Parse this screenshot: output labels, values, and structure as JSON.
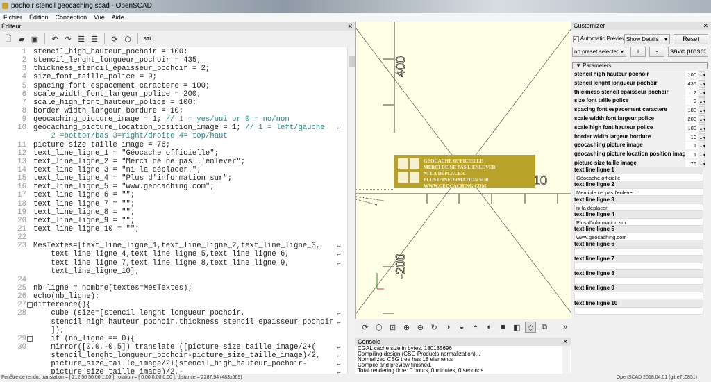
{
  "window": {
    "title": "pochoir stencil geocaching.scad - OpenSCAD"
  },
  "menu": [
    "Fichier",
    "Édition",
    "Conception",
    "Vue",
    "Aide"
  ],
  "editor": {
    "title": "Éditeur",
    "toolbar_icons": [
      "new-file-icon",
      "open-file-icon",
      "save-icon",
      "undo-icon",
      "redo-icon",
      "unindent-icon",
      "indent-icon",
      "preview-icon",
      "render-icon",
      "export-stl-icon"
    ],
    "stl_label": "STL",
    "lines": [
      {
        "n": "1",
        "t": "stencil_high_hauteur_pochoir = 100;"
      },
      {
        "n": "2",
        "t": "stencil_lenght_longueur_pochoir = 435;"
      },
      {
        "n": "3",
        "t": "thickness_stencil_epaisseur_pochoir = 2;"
      },
      {
        "n": "4",
        "t": "size_font_taille_police = 9;"
      },
      {
        "n": "5",
        "t": "spacing_font_espacement_caractere = 100;"
      },
      {
        "n": "6",
        "t": "scale_width_font_largeur_police = 200;"
      },
      {
        "n": "7",
        "t": "scale_high_font_hauteur_police = 100;"
      },
      {
        "n": "8",
        "t": "border_width_largeur_bordure = 10;"
      },
      {
        "n": "9",
        "t": "geocaching_picture_image = 1; ",
        "c": "// 1 = yes/oui or 0 = no/non"
      },
      {
        "n": "10",
        "t": "geocaching_picture_location_position_image = 1; ",
        "c": "// 1 = left/gauche",
        "w": true
      },
      {
        "n": "",
        "t": "    ",
        "c": "2 =bottom/bas 3=right/droite 4= top/haut"
      },
      {
        "n": "11",
        "t": "picture_size_taille_image = 76;"
      },
      {
        "n": "12",
        "t": "text_line_ligne_1 = \"Géocache officielle\";"
      },
      {
        "n": "13",
        "t": "text_line_ligne_2 = \"Merci de ne pas l'enlever\";"
      },
      {
        "n": "14",
        "t": "text_line_ligne_3 = \"ni la déplacer.\";"
      },
      {
        "n": "15",
        "t": "text_line_ligne_4 = \"Plus d'information sur\";"
      },
      {
        "n": "16",
        "t": "text_line_ligne_5 = \"www.geocaching.com\";"
      },
      {
        "n": "17",
        "t": "text_line_ligne_6 = \"\";"
      },
      {
        "n": "18",
        "t": "text_line_ligne_7 = \"\";"
      },
      {
        "n": "19",
        "t": "text_line_ligne_8 = \"\";"
      },
      {
        "n": "20",
        "t": "text_line_ligne_9 = \"\";"
      },
      {
        "n": "21",
        "t": "text_line_ligne_10 = \"\";"
      },
      {
        "n": "22",
        "t": ""
      },
      {
        "n": "23",
        "t": "MesTextes=[text_line_ligne_1,text_line_ligne_2,text_line_ligne_3,",
        "w": true
      },
      {
        "n": "",
        "t": "    text_line_ligne_4,text_line_ligne_5,text_line_ligne_6,",
        "w": true
      },
      {
        "n": "",
        "t": "    text_line_ligne_7,text_line_ligne_8,text_line_ligne_9,",
        "w": true
      },
      {
        "n": "",
        "t": "    text_line_ligne_10];"
      },
      {
        "n": "24",
        "t": ""
      },
      {
        "n": "25",
        "t": "nb_ligne = nombre(textes=MesTextes);"
      },
      {
        "n": "26",
        "t": "echo(nb_ligne);"
      },
      {
        "n": "27",
        "t": "difference(){",
        "f": true
      },
      {
        "n": "28",
        "t": "    cube (size=[stencil_lenght_longueur_pochoir,",
        "w": true
      },
      {
        "n": "",
        "t": "    stencil_high_hauteur_pochoir,thickness_stencil_epaisseur_pochoir",
        "w": true
      },
      {
        "n": "",
        "t": "    ]);"
      },
      {
        "n": "29",
        "t": "    if (nb_ligne == 0){",
        "f": true
      },
      {
        "n": "30",
        "t": "    mirror([0,0,-0.5]) translate ([picture_size_taille_image/2+(",
        "w": true
      },
      {
        "n": "",
        "t": "    stencil_lenght_longueur_pochoir-picture_size_taille_image)/2,",
        "w": true
      },
      {
        "n": "",
        "t": "    picture_size_taille_image/2+(stencil_high_hauteur_pochoir-",
        "w": true
      },
      {
        "n": "",
        "t": "    picture_size_taille_image)/2,-",
        "w": true
      }
    ]
  },
  "viewport": {
    "background": "#ffffe5",
    "stencil_color": "#b8a22a",
    "axis_labels": [
      "400",
      "200",
      "-200",
      "10"
    ],
    "stencil_text": [
      "GÉOCACHE OFFICIELLE",
      "MERCI DE NE PAS L'ENLEVER",
      "NI LA DÉPLACER.",
      "PLUS D'INFORMATION SUR",
      "WWW.GEOCACHING.COM"
    ],
    "toolbar_icons": [
      "preview-icon",
      "render-icon",
      "zoom-all-icon",
      "zoom-in-icon",
      "zoom-out-icon",
      "reset-view-icon",
      "view-right-icon",
      "view-top-icon",
      "view-bottom-icon",
      "view-left-icon",
      "view-front-icon",
      "view-back-icon",
      "perspective-icon",
      "orthogonal-icon"
    ],
    "more": "»"
  },
  "console": {
    "title": "Console",
    "lines": [
      "CGAL cache size in bytes: 180185696",
      "Compiling design (CSG Products normalization)...",
      "Normalized CSG tree has 18 elements",
      "Compile and preview finished.",
      "Total rendering time: 0 hours, 0 minutes, 0 seconds"
    ]
  },
  "customizer": {
    "title": "Customizer",
    "auto_preview_label": "Automatic Preview",
    "auto_preview_checked": true,
    "details_select": "Show Details",
    "reset": "Reset",
    "preset_select": "no preset selected",
    "plus": "+",
    "minus": "-",
    "save_preset": "save preset",
    "section": "Parameters",
    "params": [
      {
        "label": "stencil high hauteur pochoir",
        "value": "100"
      },
      {
        "label": "stencil lenght longueur pochoir",
        "value": "435"
      },
      {
        "label": "thickness stencil epaisseur pochoir",
        "value": "2"
      },
      {
        "label": "size font taille police",
        "value": "9"
      },
      {
        "label": "spacing font espacement caractere",
        "value": "100"
      },
      {
        "label": "scale width font largeur police",
        "value": "200"
      },
      {
        "label": "scale high font hauteur police",
        "value": "100"
      },
      {
        "label": "border width largeur bordure",
        "value": "10"
      },
      {
        "label": "geocaching picture image",
        "value": "1"
      },
      {
        "label": "geocaching picture location position image",
        "value": "1"
      },
      {
        "label": "picture size taille image",
        "value": "76"
      }
    ],
    "text_lines": [
      {
        "label": "text line ligne 1",
        "value": "Géocache officielle"
      },
      {
        "label": "text line ligne 2",
        "value": "Merci de ne pas l'enlever"
      },
      {
        "label": "text line ligne 3",
        "value": "ni la déplacer."
      },
      {
        "label": "text line ligne 4",
        "value": "Plus d'information sur"
      },
      {
        "label": "text line ligne 5",
        "value": "www.geocaching.com"
      },
      {
        "label": "text line ligne 6",
        "value": ""
      },
      {
        "label": "text line ligne 7",
        "value": ""
      },
      {
        "label": "text line ligne 8",
        "value": ""
      },
      {
        "label": "text line ligne 9",
        "value": ""
      },
      {
        "label": "text line ligne 10",
        "value": ""
      }
    ]
  },
  "statusbar": {
    "left": "Fenêtre de rendu: translation = [ 212.50 50.00 1.00 ], rotation = [ 0.00 0.00 0.00 ], distance = 2287.94 (483x669)",
    "right": "OpenSCAD 2018.04.01 (git e7c0851)"
  }
}
